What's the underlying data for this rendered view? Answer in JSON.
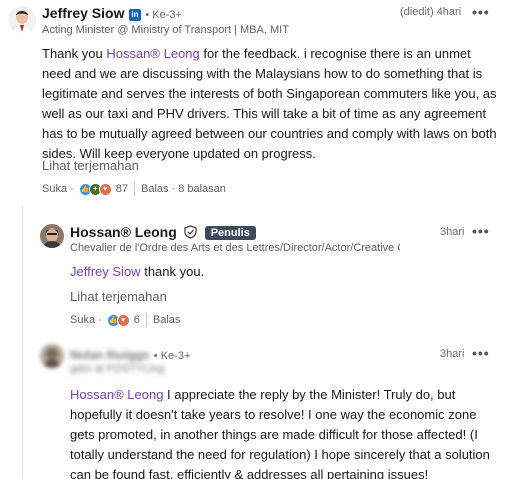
{
  "comment1": {
    "author": "Jeffrey Siow",
    "linkedin_badge": "in",
    "degree": "• Ke-3+",
    "headline": "Acting Minister @ Ministry of Transport | MBA, MIT",
    "edited": "(diedit)",
    "time": "4hari",
    "more": "•••",
    "mention": "Hossan® Leong",
    "text": "for the feedback. i recognise there is an unmet need and we are discussing with the Malaysians how to do something that is legitimate and serves the interests of both Singaporean commuters like you, as well as our taxi and PHV drivers. This will take a bit of time as any agreement has to be mutually agreed between our countries and comply with laws on both sides. Will keep everyone updated on progress.",
    "prefix": "Thank you",
    "translate": "Lihat terjemahan",
    "like": "Suka",
    "reaction_count": "87",
    "reply": "Balas",
    "replies_count": "8 balasan"
  },
  "reply1": {
    "author": "Hossan® Leong",
    "author_badge": "Penulis",
    "headline": "Chevalier de l'Ordre des Arts et des Lettres/Director/Actor/Creative Cons...",
    "time": "3hari",
    "more": "•••",
    "mention": "Jeffrey Siow",
    "text": "thank you.",
    "translate": "Lihat terjemahan",
    "like": "Suka",
    "reaction_count": "6",
    "reply": "Balas"
  },
  "reply2": {
    "author": "Nolan Ihuiggs",
    "degree": "• Ke-3+",
    "headline": "gdm at FOSTYLing",
    "time": "3hari",
    "more": "•••",
    "mention": "Hossan® Leong",
    "text": "I appreciate the reply by the Minister! Truly do, but hopefully it doesn't take years to resolve! I one way the economic zone gets promoted, in another things are made difficult for those affected! (I totally understand the need for regulation) I hope sincerely that a solution can be found fast, efficiently & addresses all pertaining issues!"
  },
  "colors": {
    "mention": "#7a3fb0",
    "linkedin_blue": "#0a66c2",
    "author_badge": "#3a4b5e",
    "like_blue": "#378fe9",
    "celebrate_green": "#44712e",
    "love_red": "#df704d"
  },
  "icons": [
    "linkedin-icon",
    "verified-shield-icon",
    "like-reaction-icon",
    "celebrate-reaction-icon",
    "love-reaction-icon",
    "more-options-icon"
  ]
}
